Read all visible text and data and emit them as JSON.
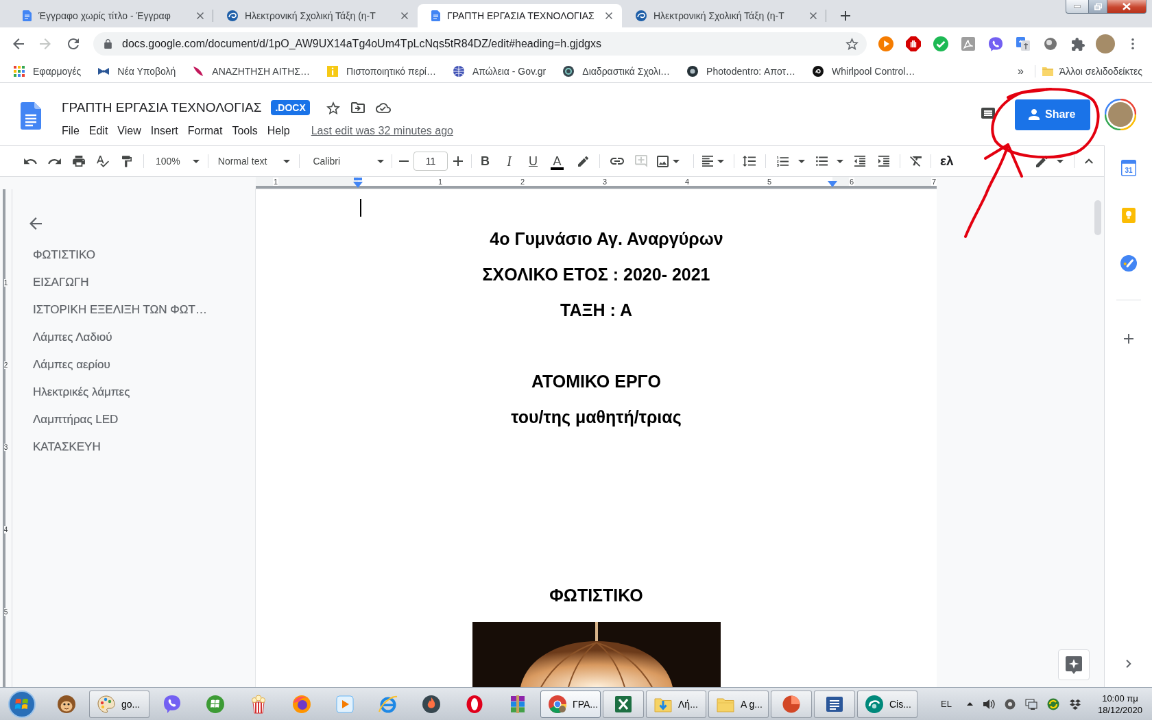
{
  "browser": {
    "tabs": [
      {
        "kind": "document",
        "title": "Έγγραφο χωρίς τίτλο - Έγγραφ",
        "selected": false
      },
      {
        "kind": "web",
        "title": "Ηλεκτρονική Σχολική Τάξη (η-Τ",
        "selected": false
      },
      {
        "kind": "document",
        "title": "ΓΡΑΠΤΗ ΕΡΓΑΣΙΑ ΤΕΧΝΟΛΟΓΙΑΣ",
        "selected": true
      },
      {
        "kind": "web",
        "title": "Ηλεκτρονική Σχολική Τάξη (η-Τ",
        "selected": false
      }
    ],
    "forward_disabled": true,
    "url": "docs.google.com/document/d/1pO_AW9UX14aTg4oUm4TpLcNqs5tR84DZ/edit#heading=h.gjdgxs",
    "bookmarks": [
      {
        "label": "Εφαρμογές"
      },
      {
        "label": "Νέα Υποβολή"
      },
      {
        "label": "ΑΝΑΖΗΤΗΣΗ ΑΙΤΗΣ…"
      },
      {
        "label": "Πιστοποιητικό περί…"
      },
      {
        "label": "Απώλεια - Gov.gr"
      },
      {
        "label": "Διαδραστικά Σχολι…"
      },
      {
        "label": "Photodentro: Αποτ…"
      },
      {
        "label": "Whirlpool Control…"
      }
    ],
    "bookmarks_overflow": "»",
    "other_bookmarks": "Άλλοι σελιδοδείκτες"
  },
  "docs": {
    "title": "ΓΡΑΠΤΗ ΕΡΓΑΣΙΑ ΤΕΧΝΟΛΟΓΙΑΣ",
    "badge": ".DOCX",
    "menu": [
      "File",
      "Edit",
      "View",
      "Insert",
      "Format",
      "Tools",
      "Help"
    ],
    "last_edit": "Last edit was 32 minutes ago",
    "share": "Share"
  },
  "toolbar": {
    "zoom": "100%",
    "style": "Normal text",
    "font": "Calibri",
    "font_size": "11",
    "format_buttons": [
      {
        "kind": "bold",
        "label": "B"
      },
      {
        "kind": "italic",
        "label": "I"
      },
      {
        "kind": "underline",
        "label": "U"
      },
      {
        "kind": "text_color",
        "label": "A"
      }
    ],
    "add_comment_disabled": true,
    "input_tools": "ελ"
  },
  "ruler": {
    "horizontal": [
      "1",
      "1",
      "2",
      "3",
      "4",
      "5",
      "6",
      "7"
    ],
    "vertical": [
      "1",
      "2",
      "3",
      "4",
      "5"
    ]
  },
  "outline": {
    "items": [
      {
        "label": "ΦΩΤΙΣΤΙΚΟ",
        "selected": false
      },
      {
        "label": "ΕΙΣΑΓΩΓΗ",
        "selected": false
      },
      {
        "label": "ΙΣΤΟΡΙΚΗ ΕΞΕΛΙΞΗ ΤΩΝ ΦΩΤ…",
        "selected": false
      },
      {
        "label": "Λάμπες Λαδιού",
        "selected": false
      },
      {
        "label": "Λάμπες αερίου",
        "selected": false
      },
      {
        "label": "Ηλεκτρικές λάμπες",
        "selected": false
      },
      {
        "label": "Λαμπτήρας LED",
        "selected": false
      },
      {
        "label": "ΚΑΤΑΣΚΕΥΗ",
        "selected": false
      }
    ]
  },
  "page": {
    "title_lines": [
      "4ο Γυμνάσιο Αγ. Αναργύρων",
      "ΣΧΟΛΙΚΟ ΕΤΟΣ : 2020- 2021",
      "ΤΑΞΗ : Α"
    ],
    "author_lines": [
      "ΑΤΟΜΙΚΟ ΕΡΓΟ",
      "του/της μαθητή/τριας"
    ],
    "section_heading": "ΦΩΤΙΣΤΙΚΟ"
  },
  "side_panel": {
    "calendar_day": "31"
  },
  "taskbar": {
    "items": [
      {
        "open": false,
        "selected": false
      },
      {
        "label": "go...",
        "open": true,
        "selected": false
      },
      {
        "open": false,
        "selected": false
      },
      {
        "open": false,
        "selected": false
      },
      {
        "open": false,
        "selected": false
      },
      {
        "open": false,
        "selected": false
      },
      {
        "open": false,
        "selected": false
      },
      {
        "open": false,
        "selected": false
      },
      {
        "open": false,
        "selected": false
      },
      {
        "open": false,
        "selected": false
      },
      {
        "open": false,
        "selected": false
      },
      {
        "label": "ΓΡΑ...",
        "open": true,
        "selected": true
      },
      {
        "open": true,
        "selected": false
      },
      {
        "label": "Λή...",
        "open": true,
        "selected": false
      },
      {
        "label": "A g...",
        "open": true,
        "selected": false
      },
      {
        "open": true,
        "selected": false
      },
      {
        "open": true,
        "selected": false
      },
      {
        "label": "Cis...",
        "open": true,
        "selected": false
      }
    ],
    "language": "EL",
    "time": "10:00 πμ",
    "date": "18/12/2020"
  }
}
